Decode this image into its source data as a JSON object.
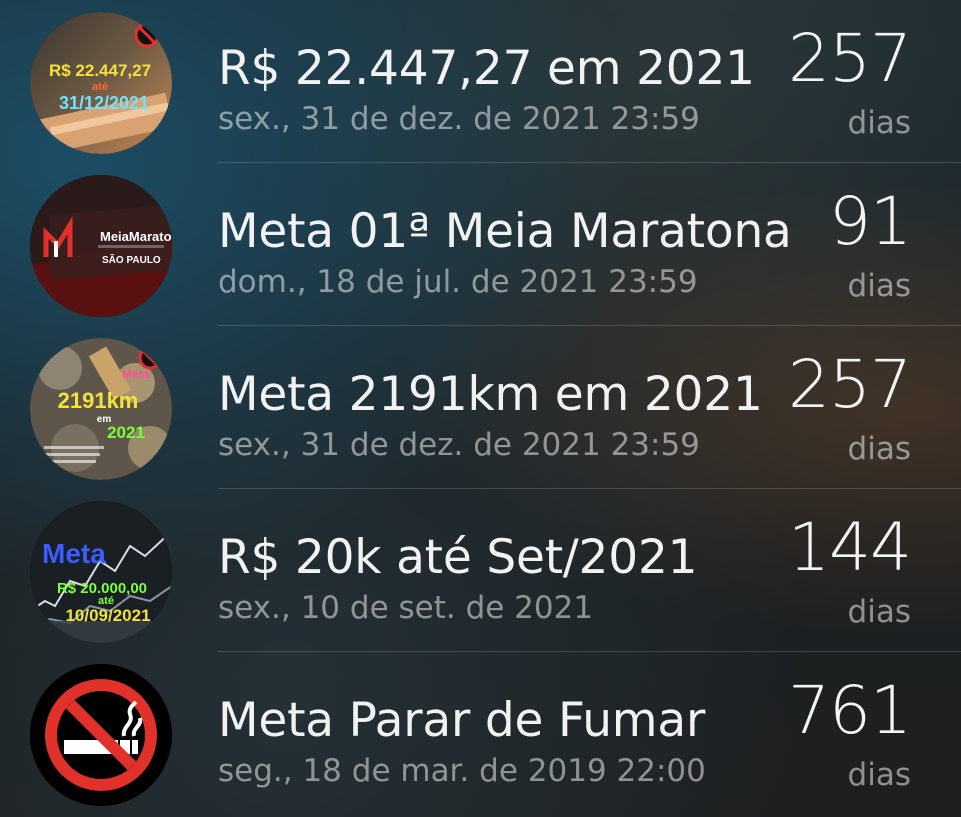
{
  "countdowns": [
    {
      "title": "R$ 22.447,27 em 2021",
      "date": "sex., 31 de dez. de 2021 23:59",
      "count": "257",
      "unit": "dias",
      "image": {
        "line1": "R$ 22.447,27",
        "line2": "até",
        "line3": "31/12/2021"
      }
    },
    {
      "title": "Meta 01ª Meia Maratona",
      "date": "dom., 18 de jul. de 2021 23:59",
      "count": "91",
      "unit": "dias",
      "image": {
        "brand": "MeiaMaratona",
        "sub": "SÃO PAULO"
      }
    },
    {
      "title": "Meta 2191km em 2021",
      "date": "sex., 31 de dez. de 2021 23:59",
      "count": "257",
      "unit": "dias",
      "image": {
        "line1": "Meta",
        "line2": "2191km",
        "line3": "em",
        "line4": "2021"
      }
    },
    {
      "title": "R$ 20k até Set/2021",
      "date": "sex., 10 de set. de 2021",
      "count": "144",
      "unit": "dias",
      "image": {
        "line1": "Meta",
        "line2": "R$ 20.000,00",
        "line3": "até",
        "line4": "10/09/2021"
      }
    },
    {
      "title": "Meta Parar de Fumar",
      "date": "seg., 18 de mar. de 2019 22:00",
      "count": "761",
      "unit": "dias"
    }
  ],
  "colors": {
    "no_smoking_red": "#e0312b",
    "yellow_text": "#f2e33a",
    "cyan_text": "#6fe3ff",
    "blue_text": "#3d5cff",
    "green_text": "#7bff3a"
  }
}
